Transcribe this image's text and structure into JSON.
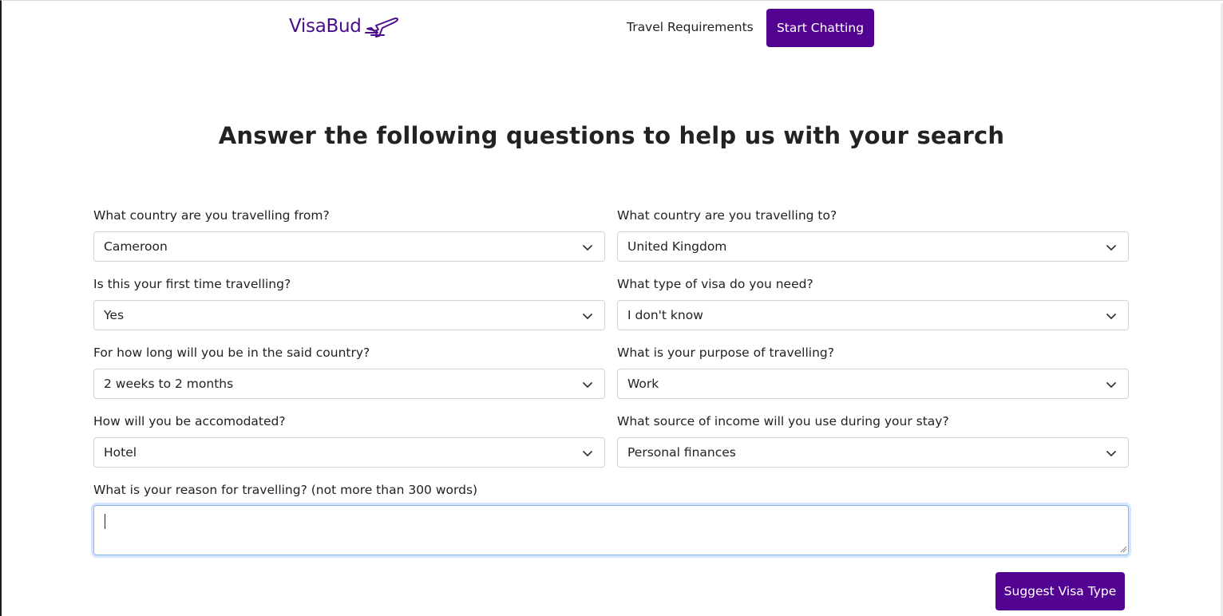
{
  "header": {
    "logo_text": "VisaBud",
    "logo_icon": "airplane-takeoff-icon",
    "nav_link": "Travel Requirements",
    "cta_button": "Start Chatting"
  },
  "main": {
    "title": "Answer the following questions to help us with your search"
  },
  "form": {
    "fields": [
      {
        "label": "What country are you travelling from?",
        "value": "Cameroon"
      },
      {
        "label": "What country are you travelling to?",
        "value": "United Kingdom"
      },
      {
        "label": "Is this your first time travelling?",
        "value": "Yes"
      },
      {
        "label": "What type of visa do you need?",
        "value": "I don't know"
      },
      {
        "label": "For how long will you be in the said country?",
        "value": "2 weeks to 2 months"
      },
      {
        "label": "What is your purpose of travelling?",
        "value": "Work"
      },
      {
        "label": "How will you be accomodated?",
        "value": "Hotel"
      },
      {
        "label": "What source of income will you use during your stay?",
        "value": "Personal finances"
      }
    ],
    "reason": {
      "label": "What is your reason for travelling? (not more than 300 words)",
      "value": ""
    },
    "submit_label": "Suggest Visa Type"
  },
  "colors": {
    "brand": "#530392",
    "logo": "#4b0e8a",
    "focus_border": "#8bb5ea"
  }
}
